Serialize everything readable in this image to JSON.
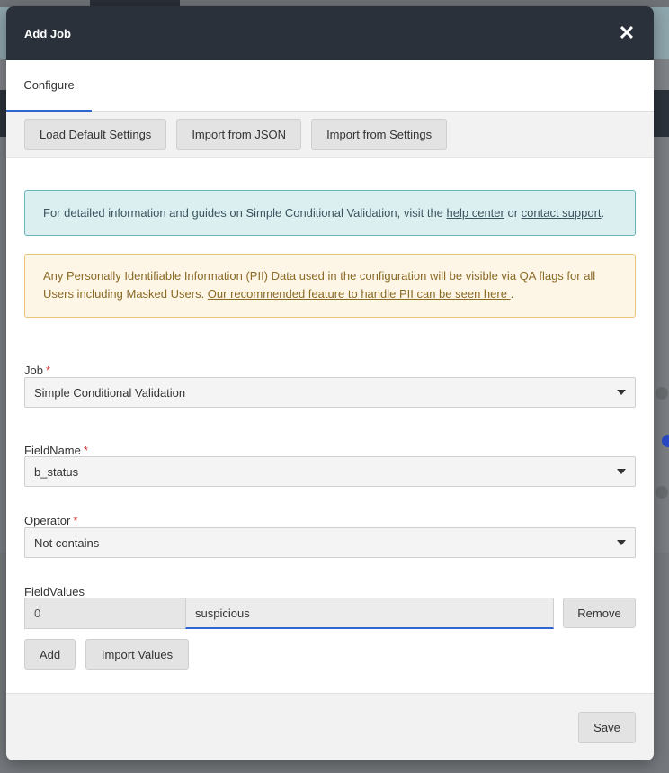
{
  "modal": {
    "title": "Add Job",
    "close_icon": "close-icon"
  },
  "tabs": [
    {
      "label": "Configure",
      "active": true
    }
  ],
  "toolbar": {
    "load_default_label": "Load Default Settings",
    "import_json_label": "Import from JSON",
    "import_settings_label": "Import from Settings"
  },
  "info_alert": {
    "text_before": "For detailed information and guides on Simple Conditional Validation, visit the ",
    "help_link": "help center",
    "text_middle": " or ",
    "support_link": "contact support",
    "text_after": "."
  },
  "warning_alert": {
    "text": "Any Personally Identifiable Information (PII) Data used in the configuration will be visible via QA flags for all Users including Masked Users. ",
    "link": "Our recommended feature to handle PII can be seen here ",
    "text_after": "."
  },
  "form": {
    "job": {
      "label": "Job",
      "required_mark": "*",
      "value": "Simple Conditional Validation"
    },
    "field_name": {
      "label": "FieldName",
      "required_mark": "*",
      "value": "b_status"
    },
    "operator": {
      "label": "Operator",
      "required_mark": "*",
      "value": "Not contains"
    },
    "field_values": {
      "label": "FieldValues",
      "rows": [
        {
          "index": "0",
          "value": "suspicious",
          "remove_label": "Remove"
        }
      ],
      "add_label": "Add",
      "import_values_label": "Import Values"
    }
  },
  "footer": {
    "save_label": "Save"
  },
  "colors": {
    "header_bg": "#2b313b",
    "accent": "#2f66d0",
    "info_bg": "#dceff0",
    "warning_bg": "#fdf5e6",
    "required": "#d93535"
  }
}
